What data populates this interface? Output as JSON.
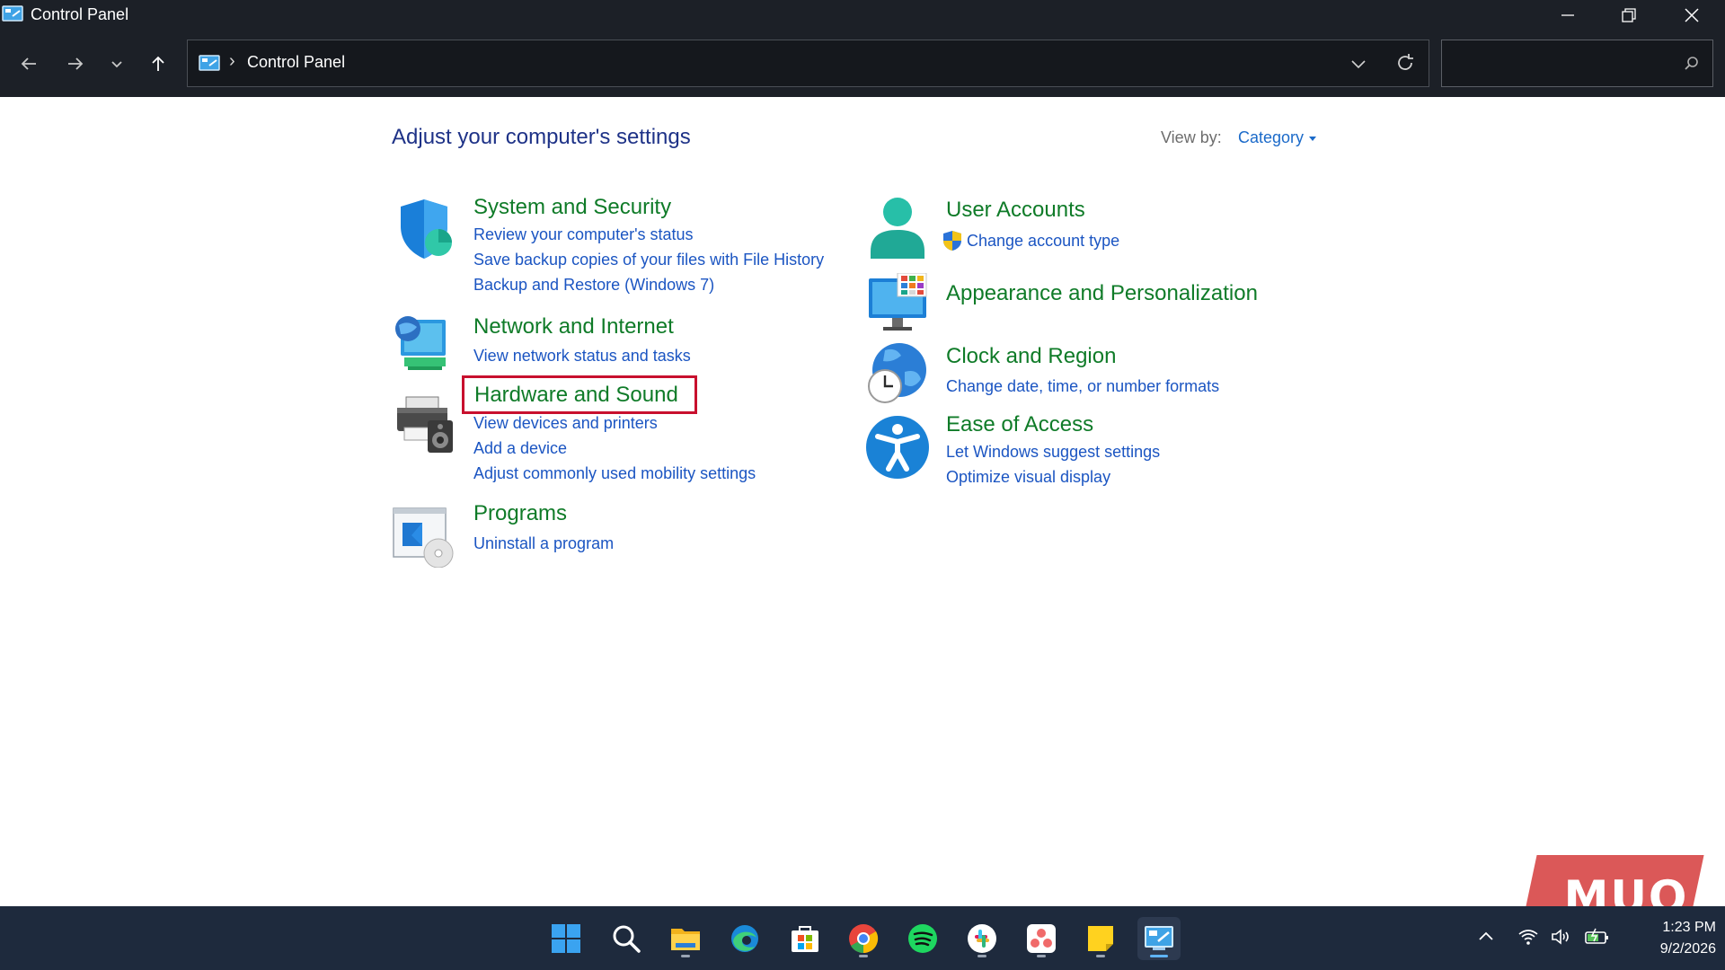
{
  "window": {
    "title": "Control Panel",
    "accent": "#1c2027"
  },
  "address_bar": {
    "breadcrumb": "Control Panel",
    "separator": "›",
    "search_placeholder": ""
  },
  "header": {
    "title": "Adjust your computer's settings",
    "view_by_label": "View by:",
    "view_by_value": "Category"
  },
  "categories": {
    "system_security": {
      "title": "System and Security",
      "icon": "shield-icon",
      "links": [
        "Review your computer's status",
        "Save backup copies of your files with File History",
        "Backup and Restore (Windows 7)"
      ]
    },
    "network_internet": {
      "title": "Network and Internet",
      "icon": "network-globe-icon",
      "links": [
        "View network status and tasks"
      ]
    },
    "hardware_sound": {
      "title": "Hardware and Sound",
      "icon": "printer-speaker-icon",
      "links": [
        "View devices and printers",
        "Add a device",
        "Adjust commonly used mobility settings"
      ]
    },
    "programs": {
      "title": "Programs",
      "icon": "programs-disc-icon",
      "links": [
        "Uninstall a program"
      ]
    },
    "user_accounts": {
      "title": "User Accounts",
      "icon": "user-icon",
      "links": [
        "Change account type"
      ]
    },
    "appearance": {
      "title": "Appearance and Personalization",
      "icon": "monitor-tiles-icon",
      "links": []
    },
    "clock_region": {
      "title": "Clock and Region",
      "icon": "globe-clock-icon",
      "links": [
        "Change date, time, or number formats"
      ]
    },
    "ease_access": {
      "title": "Ease of Access",
      "icon": "accessibility-icon",
      "links": [
        "Let Windows suggest settings",
        "Optimize visual display"
      ]
    }
  },
  "colors": {
    "category_title": "#0f7b28",
    "link": "#1b55c2",
    "heading": "#1e3287",
    "highlight_box": "#c8102e"
  },
  "watermark": "MUO",
  "taskbar": {
    "apps": [
      "start-icon",
      "search-icon",
      "file-explorer-icon",
      "edge-icon",
      "store-icon",
      "chrome-icon",
      "spotify-icon",
      "slack-icon",
      "asana-icon",
      "sticky-notes-icon",
      "control-panel-icon"
    ],
    "time": "1:23 PM",
    "date": "9/2/2026"
  }
}
